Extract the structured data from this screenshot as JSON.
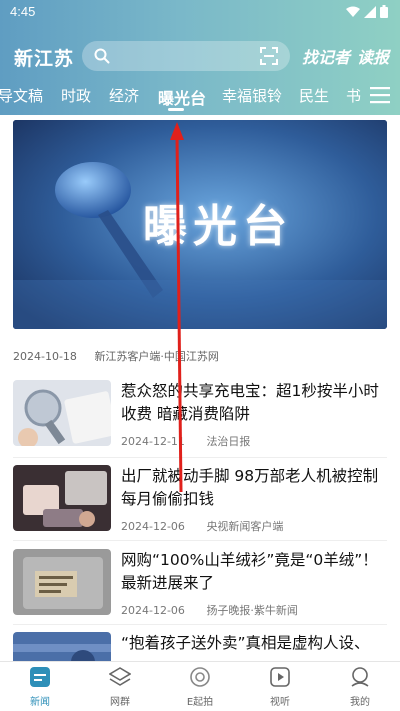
{
  "status": {
    "time": "4:45"
  },
  "header": {
    "app_name": "新江苏",
    "reporter_label": "找记者",
    "read_label": "读报"
  },
  "tabs": [
    {
      "label": "导文稿"
    },
    {
      "label": "时政"
    },
    {
      "label": "经济"
    },
    {
      "label": "曝光台"
    },
    {
      "label": "幸福银铃"
    },
    {
      "label": "民生"
    },
    {
      "label": "书"
    }
  ],
  "banner": {
    "title": "曝光台",
    "date": "2024-10-18",
    "source": "新江苏客户端·中国江苏网"
  },
  "articles": [
    {
      "title": "惹众怒的共享充电宝：超1秒按半小时收费 暗藏消费陷阱",
      "date": "2024-12-11",
      "source": "法治日报"
    },
    {
      "title": "出厂就被动手脚 98万部老人机被控制每月偷偷扣钱",
      "date": "2024-12-06",
      "source": "央视新闻客户端"
    },
    {
      "title": "网购“100%山羊绒衫”竟是“0羊绒”！最新进展来了",
      "date": "2024-12-06",
      "source": "扬子晚报·紫牛新闻"
    },
    {
      "title": "“抱着孩子送外卖”真相是虚构人设、",
      "date": "",
      "source": ""
    }
  ],
  "bottom_nav": [
    {
      "label": "新闻",
      "icon": "news-icon",
      "active": true
    },
    {
      "label": "网群",
      "icon": "layers-icon",
      "active": false
    },
    {
      "label": "E起拍",
      "icon": "camera-icon",
      "active": false
    },
    {
      "label": "视听",
      "icon": "play-icon",
      "active": false
    },
    {
      "label": "我的",
      "icon": "user-icon",
      "active": false
    }
  ],
  "colors": {
    "accent": "#2e8fb8",
    "annotation_arrow": "#e0201b"
  }
}
